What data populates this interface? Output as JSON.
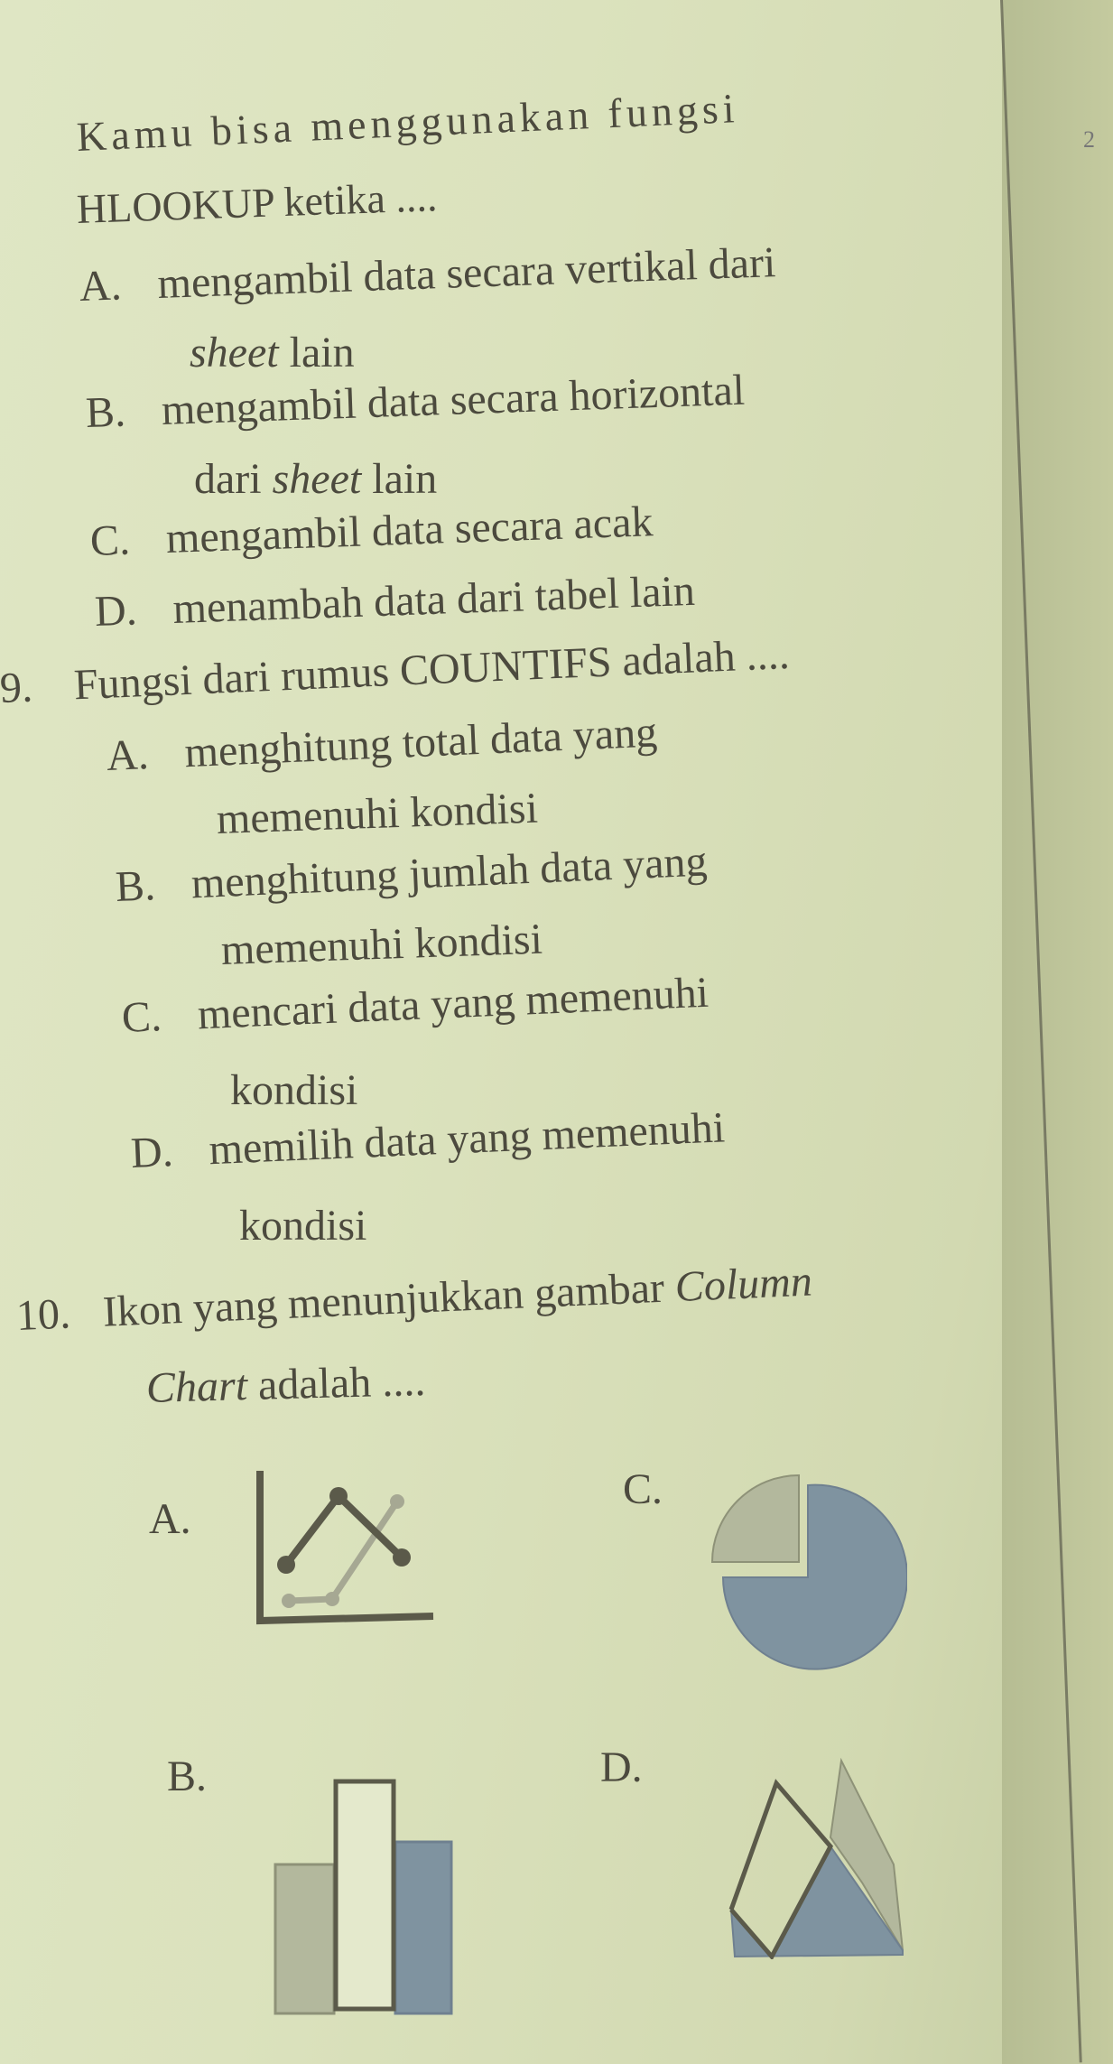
{
  "page": {
    "margin_mark": "2"
  },
  "question8": {
    "text_line1": "Kamu bisa menggunakan fungsi",
    "text_line2": "HLOOKUP ketika ....",
    "options": [
      {
        "letter": "A.",
        "line1": "mengambil data secara vertikal dari",
        "line2_italic": "sheet",
        "line2_rest": " lain"
      },
      {
        "letter": "B.",
        "line1": "mengambil data secara horizontal",
        "line2_pre": "dari ",
        "line2_italic": "sheet",
        "line2_rest": " lain"
      },
      {
        "letter": "C.",
        "line1": "mengambil data secara acak"
      },
      {
        "letter": "D.",
        "line1": "menambah data dari tabel lain"
      }
    ]
  },
  "question9": {
    "number": "9.",
    "text": "Fungsi dari rumus COUNTIFS adalah ....",
    "options": [
      {
        "letter": "A.",
        "line1": "menghitung total data yang",
        "line2": "memenuhi kondisi"
      },
      {
        "letter": "B.",
        "line1": "menghitung jumlah data yang",
        "line2": "memenuhi kondisi"
      },
      {
        "letter": "C.",
        "line1": "mencari data yang memenuhi",
        "line2": "kondisi"
      },
      {
        "letter": "D.",
        "line1": "memilih data yang memenuhi",
        "line2": "kondisi"
      }
    ]
  },
  "question10": {
    "number": "10.",
    "text_line1_pre": "Ikon yang menunjukkan gambar ",
    "text_line1_italic": "Column",
    "text_line2_italic": "Chart",
    "text_line2_rest": " adalah ....",
    "options": [
      {
        "letter": "A.",
        "icon": "line-chart-icon"
      },
      {
        "letter": "B.",
        "icon": "column-chart-icon"
      },
      {
        "letter": "C.",
        "icon": "pie-chart-icon"
      },
      {
        "letter": "D.",
        "icon": "area-chart-icon"
      }
    ]
  },
  "colors": {
    "ink": "#4c4a3e",
    "chart_blue": "#7f93a0",
    "chart_gray": "#b3b89d",
    "chart_dark": "#5b5a4a"
  }
}
